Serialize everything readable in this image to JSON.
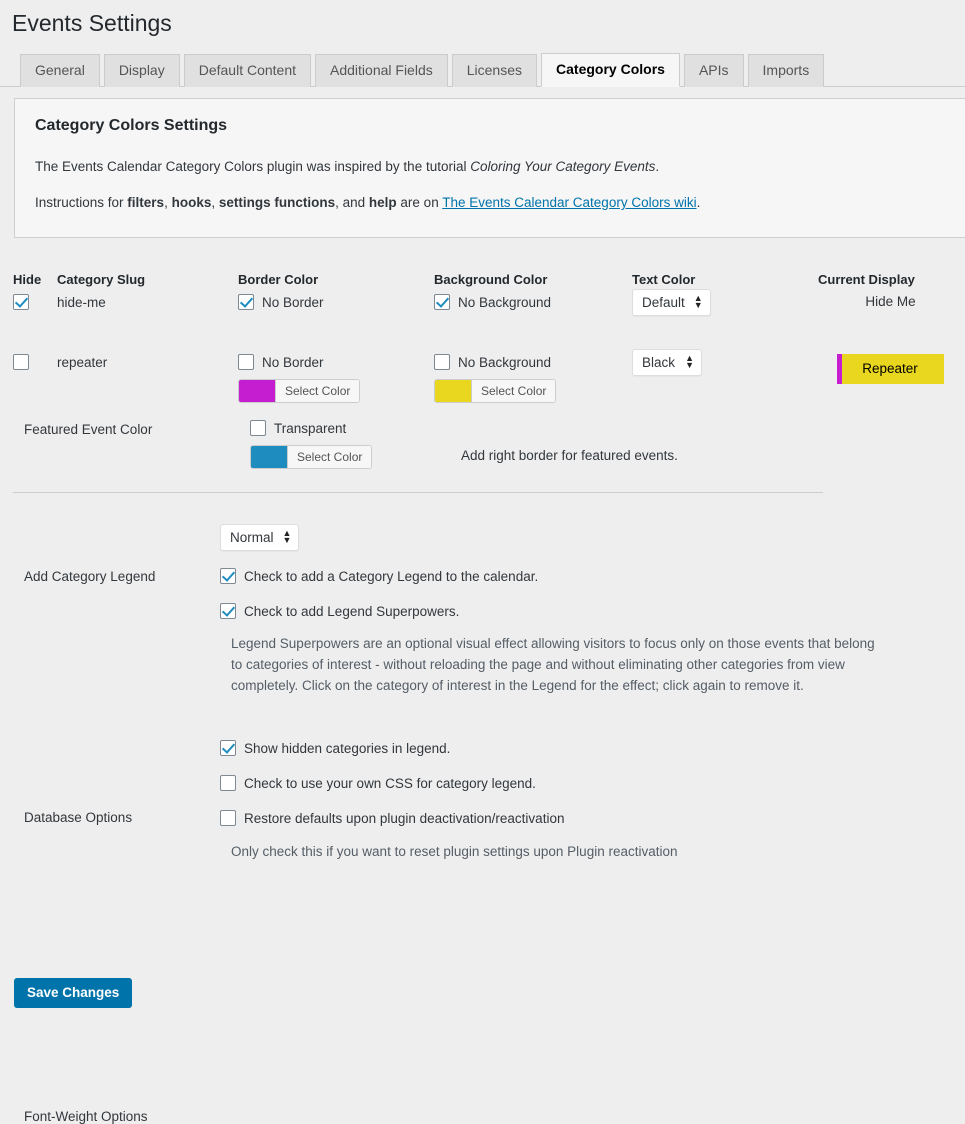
{
  "page": {
    "title": "Events Settings"
  },
  "tabs": [
    {
      "label": "General",
      "active": false
    },
    {
      "label": "Display",
      "active": false
    },
    {
      "label": "Default Content",
      "active": false
    },
    {
      "label": "Additional Fields",
      "active": false
    },
    {
      "label": "Licenses",
      "active": false
    },
    {
      "label": "Category Colors",
      "active": true
    },
    {
      "label": "APIs",
      "active": false
    },
    {
      "label": "Imports",
      "active": false
    }
  ],
  "info_panel": {
    "heading": "Category Colors Settings",
    "line1_before": "The Events Calendar Category Colors plugin was inspired by the tutorial ",
    "line1_em": "Coloring Your Category Events",
    "line1_after": ".",
    "line2_before": "Instructions for ",
    "line2_b1": "filters",
    "line2_sep1": ", ",
    "line2_b2": "hooks",
    "line2_sep2": ", ",
    "line2_b3": "settings functions",
    "line2_mid": ", and ",
    "line2_b4": "help",
    "line2_after": " are on ",
    "link_text": "The Events Calendar Category Colors wiki",
    "line2_end": "."
  },
  "table": {
    "headers": {
      "hide": "Hide",
      "slug": "Category Slug",
      "border": "Border Color",
      "background": "Background Color",
      "text": "Text Color",
      "display": "Current Display"
    },
    "rows": [
      {
        "hide_checked": true,
        "slug": "hide-me",
        "border_nocolor_label": "No Border",
        "border_nocolor_checked": true,
        "border_has_picker": false,
        "border_swatch": "",
        "bg_nocolor_label": "No Background",
        "bg_nocolor_checked": true,
        "bg_has_picker": false,
        "bg_swatch": "",
        "select_color_label": "Select Color",
        "text_color": "Default",
        "display_text": "Hide Me",
        "display_is_badge": false,
        "display_bg": "",
        "display_border": "",
        "display_color": ""
      },
      {
        "hide_checked": false,
        "slug": "repeater",
        "border_nocolor_label": "No Border",
        "border_nocolor_checked": false,
        "border_has_picker": true,
        "border_swatch": "#c41ed0",
        "bg_nocolor_label": "No Background",
        "bg_nocolor_checked": false,
        "bg_has_picker": true,
        "bg_swatch": "#e8d71e",
        "select_color_label": "Select Color",
        "text_color": "Black",
        "display_text": "Repeater",
        "display_is_badge": true,
        "display_bg": "#e8d71e",
        "display_border": "#c41ed0",
        "display_color": "#000000"
      }
    ]
  },
  "featured": {
    "label": "Featured Event Color",
    "transparent_label": "Transparent",
    "transparent_checked": false,
    "swatch": "#1e8cbe",
    "select_color_label": "Select Color",
    "note": "Add right border for featured events."
  },
  "options": {
    "font_weight_label": "Font-Weight Options",
    "font_weight_value": "Normal",
    "legend_label": "Add Category Legend",
    "legend_checkbox_label": "Check to add a Category Legend to the calendar.",
    "legend_checked": true,
    "superpowers_checkbox_label": "Check to add Legend Superpowers.",
    "superpowers_checked": true,
    "superpowers_help": "Legend Superpowers are an optional visual effect allowing visitors to focus only on those events that belong to categories of interest - without reloading the page and without eliminating other categories from view completely. Click on the category of interest in the Legend for the effect; click again to remove it.",
    "show_hidden_label": "Show hidden categories in legend.",
    "show_hidden_checked": true,
    "own_css_label": "Check to use your own CSS for category legend.",
    "own_css_checked": false,
    "database_label": "Database Options",
    "restore_defaults_label": "Restore defaults upon plugin deactivation/reactivation",
    "restore_defaults_checked": false,
    "restore_help": "Only check this if you want to reset plugin settings upon Plugin reactivation"
  },
  "save": {
    "label": "Save Changes"
  },
  "colors": {
    "accent": "#0073aa",
    "checkmark": "#1e8cbe",
    "page_bg": "#eeeeee",
    "panel_bg": "#f6f6f6"
  }
}
